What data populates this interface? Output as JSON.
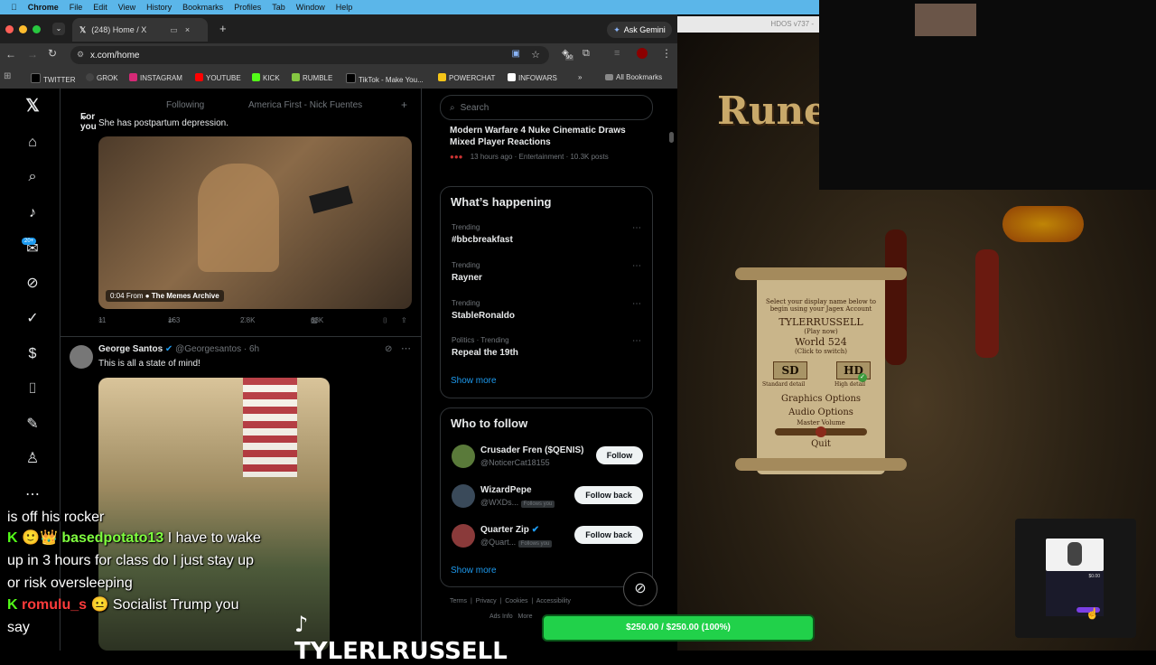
{
  "menubar": {
    "app": "Chrome",
    "items": [
      "File",
      "Edit",
      "View",
      "History",
      "Bookmarks",
      "Profiles",
      "Tab",
      "Window",
      "Help"
    ]
  },
  "browser": {
    "tab_title": "(248) Home / X",
    "ask_gemini": "Ask Gemini",
    "url": "x.com/home",
    "extension_badge": "90",
    "bookmarks": [
      {
        "label": "TWITTER",
        "color": "#000000"
      },
      {
        "label": "GROK",
        "color": "#444444"
      },
      {
        "label": "INSTAGRAM",
        "color": "#d62976"
      },
      {
        "label": "YOUTUBE",
        "color": "#ff0000"
      },
      {
        "label": "KICK",
        "color": "#53fc18"
      },
      {
        "label": "RUMBLE",
        "color": "#85c742"
      },
      {
        "label": "TikTok - Make You...",
        "color": "#000000"
      },
      {
        "label": "POWERCHAT",
        "color": "#f5c518"
      },
      {
        "label": "INFOWARS",
        "color": "#ffffff"
      }
    ],
    "overflow": "»",
    "all_bookmarks": "All Bookmarks"
  },
  "x": {
    "notifications_badge": "20+",
    "tabs": {
      "for_you": "For you",
      "following": "Following",
      "list": "America First - Nick Fuentes"
    },
    "post1": {
      "text": "She has postpartum depression.",
      "video_time": "0:04",
      "video_from": "From",
      "video_source": "The Memes Archive",
      "replies": "11",
      "reposts": "163",
      "likes": "2.8K",
      "views": "63K"
    },
    "post2": {
      "name": "George Santos",
      "handle": "@Georgesantos · 6h",
      "text": "This is all a state of mind!"
    },
    "search_placeholder": "Search",
    "top_story": {
      "title": "Modern Warfare 4 Nuke Cinematic Draws Mixed Player Reactions",
      "meta": "13 hours ago · Entertainment · 10.3K posts"
    },
    "whats_happening": {
      "heading": "What’s happening",
      "trends": [
        {
          "context": "Trending",
          "topic": "#bbcbreakfast"
        },
        {
          "context": "Trending",
          "topic": "Rayner"
        },
        {
          "context": "Trending",
          "topic": "StableRonaldo"
        },
        {
          "context": "Politics · Trending",
          "topic": "Repeal the 19th"
        }
      ],
      "show_more": "Show more"
    },
    "who_to_follow": {
      "heading": "Who to follow",
      "people": [
        {
          "name": "Crusader Fren ($QENIS)",
          "handle": "@NoticerCat18155",
          "follows_you": "",
          "button": "Follow"
        },
        {
          "name": "WizardPepe",
          "handle": "@WXDs...",
          "follows_you": "Follows you",
          "button": "Follow back"
        },
        {
          "name": "Quarter Zip",
          "handle": "@Quart...",
          "follows_you": "Follows you",
          "button": "Follow back"
        }
      ],
      "show_more": "Show more"
    },
    "footer": {
      "terms": "Terms",
      "privacy": "Privacy",
      "cookies": "Cookies",
      "accessibility": "Accessibility",
      "ads": "Ads Info",
      "more": "More"
    }
  },
  "game": {
    "window_title": "HDOS v737 -",
    "logo": "Rune",
    "panel": {
      "intro": "Select your display name below to begin using your Jagex Account",
      "username": "TYLERRUSSELL",
      "play_now": "(Play now)",
      "world": "World 524",
      "click_to_switch": "(Click to switch)",
      "sd": "SD",
      "hd": "HD",
      "standard_detail": "Standard detail",
      "high_detail": "High detail",
      "graphics": "Graphics Options",
      "audio": "Audio Options",
      "master_volume": "Master Volume",
      "quit": "Quit"
    }
  },
  "stream": {
    "chat_lines": [
      {
        "user": "",
        "message": "is off his rocker"
      },
      {
        "user": "basedpotato13",
        "message": "I have to wake up in 3 hours for class do I just stay up or risk oversleeping"
      },
      {
        "user": "romulu_s",
        "message": "Socialist Trump you say"
      }
    ],
    "goal": "$250.00 / $250.00 (100%)",
    "tiktok_name": "TYLERLRUSSELL",
    "ad_price": "$0.00"
  }
}
